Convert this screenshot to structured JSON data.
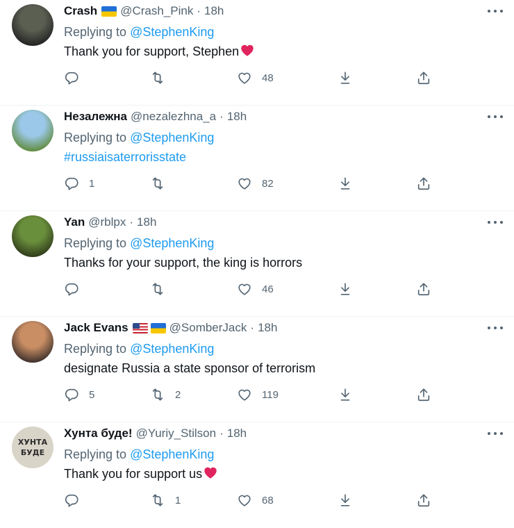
{
  "tweets": [
    {
      "name": "Crash",
      "flags": [
        "ua"
      ],
      "handle": "@Crash_Pink",
      "dot": "·",
      "time": "18h",
      "replying_prefix": "Replying to",
      "replying_to": "@StephenKing",
      "text": "Thank you for support, Stephen",
      "text_type": "plain",
      "emoji": "red-heart",
      "replies": "",
      "retweets": "",
      "likes": "48",
      "avatar_colors": [
        "#5b5f52",
        "#222"
      ]
    },
    {
      "name": "Незалежна",
      "flags": [],
      "handle": "@nezalezhna_a",
      "dot": "·",
      "time": "18h",
      "replying_prefix": "Replying to",
      "replying_to": "@StephenKing",
      "text": "#russiaisaterrorisstate",
      "text_type": "hashtag",
      "emoji": "",
      "replies": "1",
      "retweets": "",
      "likes": "82",
      "avatar_colors": [
        "#9bc8e8",
        "#5f8a3a"
      ]
    },
    {
      "name": "Yan",
      "flags": [],
      "handle": "@rblpx",
      "dot": "·",
      "time": "18h",
      "replying_prefix": "Replying to",
      "replying_to": "@StephenKing",
      "text": "Thanks for your support, the king is horrors",
      "text_type": "plain",
      "emoji": "",
      "replies": "",
      "retweets": "",
      "likes": "46",
      "avatar_colors": [
        "#6a8f3c",
        "#2e3a1a"
      ]
    },
    {
      "name": "Jack Evans",
      "flags": [
        "us",
        "ua"
      ],
      "handle": "@SomberJack",
      "dot": "·",
      "time": "18h",
      "replying_prefix": "Replying to",
      "replying_to": "@StephenKing",
      "text": "designate Russia a state sponsor of terrorism",
      "text_type": "plain",
      "emoji": "",
      "replies": "5",
      "retweets": "2",
      "likes": "119",
      "avatar_colors": [
        "#c98e64",
        "#3b2f2a"
      ]
    },
    {
      "name": "Хунта буде!",
      "flags": [],
      "handle": "@Yuriy_Stilson",
      "dot": "·",
      "time": "18h",
      "replying_prefix": "Replying to",
      "replying_to": "@StephenKing",
      "text": "Thank you for support us",
      "text_type": "plain",
      "emoji": "red-heart",
      "replies": "",
      "retweets": "1",
      "likes": "68",
      "avatar_colors": [
        "#d9d4c8",
        "#2b2b2b"
      ],
      "avatar_text": [
        "ХУНТА",
        "БУДЕ"
      ]
    }
  ],
  "colors": {
    "accent": "#1d9bf0",
    "muted": "#536471",
    "text": "#0f1419",
    "heart": "#e0245e",
    "divider": "#eff3f4"
  },
  "icons": {
    "more": "more-horizontal-icon",
    "reply": "reply-icon",
    "retweet": "retweet-icon",
    "like": "heart-icon",
    "download": "download-icon",
    "share": "share-icon"
  }
}
